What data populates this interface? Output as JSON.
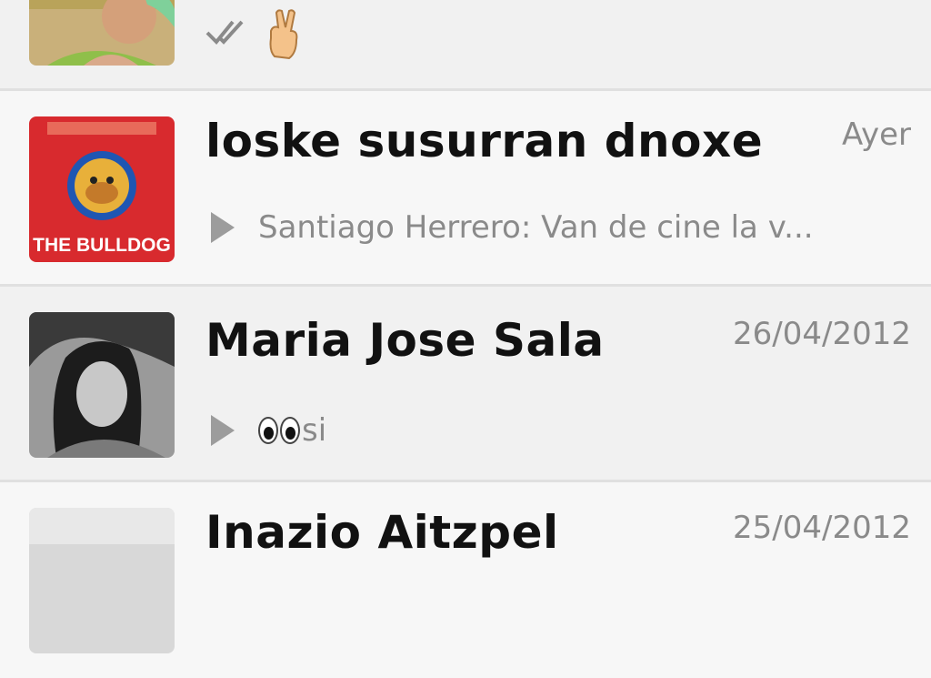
{
  "chats": [
    {
      "title": "",
      "time": "",
      "preview": "",
      "status_icon": "double-check-icon",
      "preview_emoji": "victory-hand-emoji"
    },
    {
      "title": "loske susurran dnoxe",
      "time": "Ayer",
      "preview": "Santiago Herrero: Van de cine la v...",
      "avatar_text": "THE BULLDOG"
    },
    {
      "title": "Maria Jose Sala",
      "time": "26/04/2012",
      "preview": "si",
      "preview_emoji": "eyes-emoji"
    },
    {
      "title": "Inazio Aitzpel",
      "time": "25/04/2012"
    }
  ],
  "colors": {
    "background": "#f1f1f1",
    "title": "#111111",
    "secondary_text": "#8a8a8a",
    "divider": "#e0e0e0",
    "bulldog_red": "#d82a2e"
  }
}
